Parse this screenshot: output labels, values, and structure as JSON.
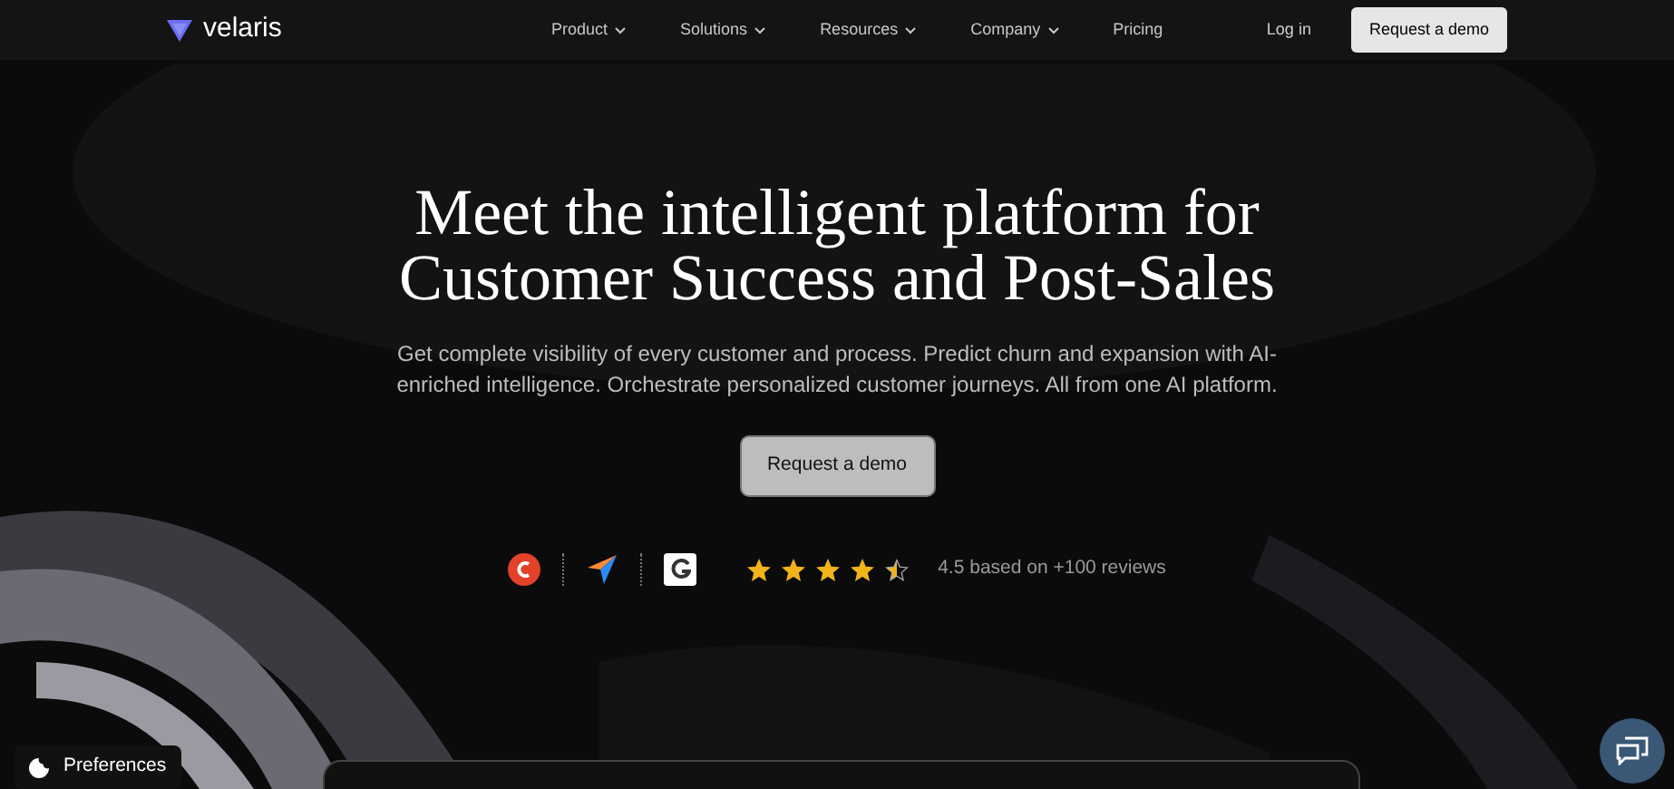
{
  "brand": "velaris",
  "nav": [
    {
      "label": "Product",
      "dropdown": true
    },
    {
      "label": "Solutions",
      "dropdown": true
    },
    {
      "label": "Resources",
      "dropdown": true
    },
    {
      "label": "Company",
      "dropdown": true
    },
    {
      "label": "Pricing",
      "dropdown": false
    }
  ],
  "login": "Log in",
  "nav_cta": "Request a demo",
  "hero": {
    "title_lines": [
      "Meet the intelligent platform for",
      "Customer Success and Post-Sales"
    ],
    "subtitle": "Get complete visibility of every customer and process. Predict churn and expansion with AI-enriched intelligence. Orchestrate personalized customer journeys. All from one AI platform.",
    "cta": "Request a demo"
  },
  "rating": {
    "stars": 4.5,
    "text": "4.5 based on +100 reviews"
  },
  "preferences": "Preferences"
}
